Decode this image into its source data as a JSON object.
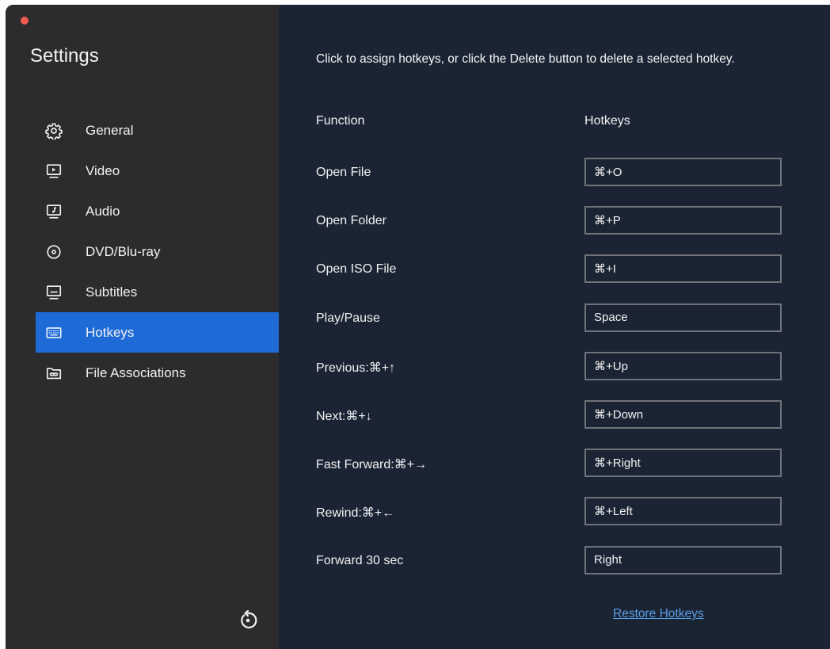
{
  "window": {
    "close_color": "#ef5a4f"
  },
  "sidebar": {
    "title": "Settings",
    "active_color": "#1e6ad6",
    "items": [
      {
        "label": "General",
        "icon": "gear-icon"
      },
      {
        "label": "Video",
        "icon": "video-icon"
      },
      {
        "label": "Audio",
        "icon": "audio-icon"
      },
      {
        "label": "DVD/Blu-ray",
        "icon": "disc-icon"
      },
      {
        "label": "Subtitles",
        "icon": "subtitles-icon"
      },
      {
        "label": "Hotkeys",
        "icon": "keyboard-icon"
      },
      {
        "label": "File Associations",
        "icon": "folder-link-icon"
      }
    ],
    "active_item": "Hotkeys",
    "reset_icon": "reset-icon"
  },
  "main": {
    "instructions": "Click to assign hotkeys, or click the Delete button to delete a selected hotkey.",
    "header_function": "Function",
    "header_hotkeys": "Hotkeys",
    "rows": [
      {
        "function": "Open File",
        "hotkey": "⌘+O"
      },
      {
        "function": "Open Folder",
        "hotkey": "⌘+P"
      },
      {
        "function": "Open ISO File",
        "hotkey": "⌘+I"
      },
      {
        "function": "Play/Pause",
        "hotkey": "Space"
      },
      {
        "function": "Previous:⌘+↑",
        "hotkey": "⌘+Up"
      },
      {
        "function": "Next:⌘+↓",
        "hotkey": "⌘+Down"
      },
      {
        "function": "Fast Forward:⌘+→",
        "hotkey": "⌘+Right"
      },
      {
        "function": "Rewind:⌘+←",
        "hotkey": "⌘+Left"
      },
      {
        "function": "Forward 30 sec",
        "hotkey": "Right"
      }
    ],
    "restore_label": "Restore Hotkeys",
    "link_color": "#5b9de6"
  }
}
